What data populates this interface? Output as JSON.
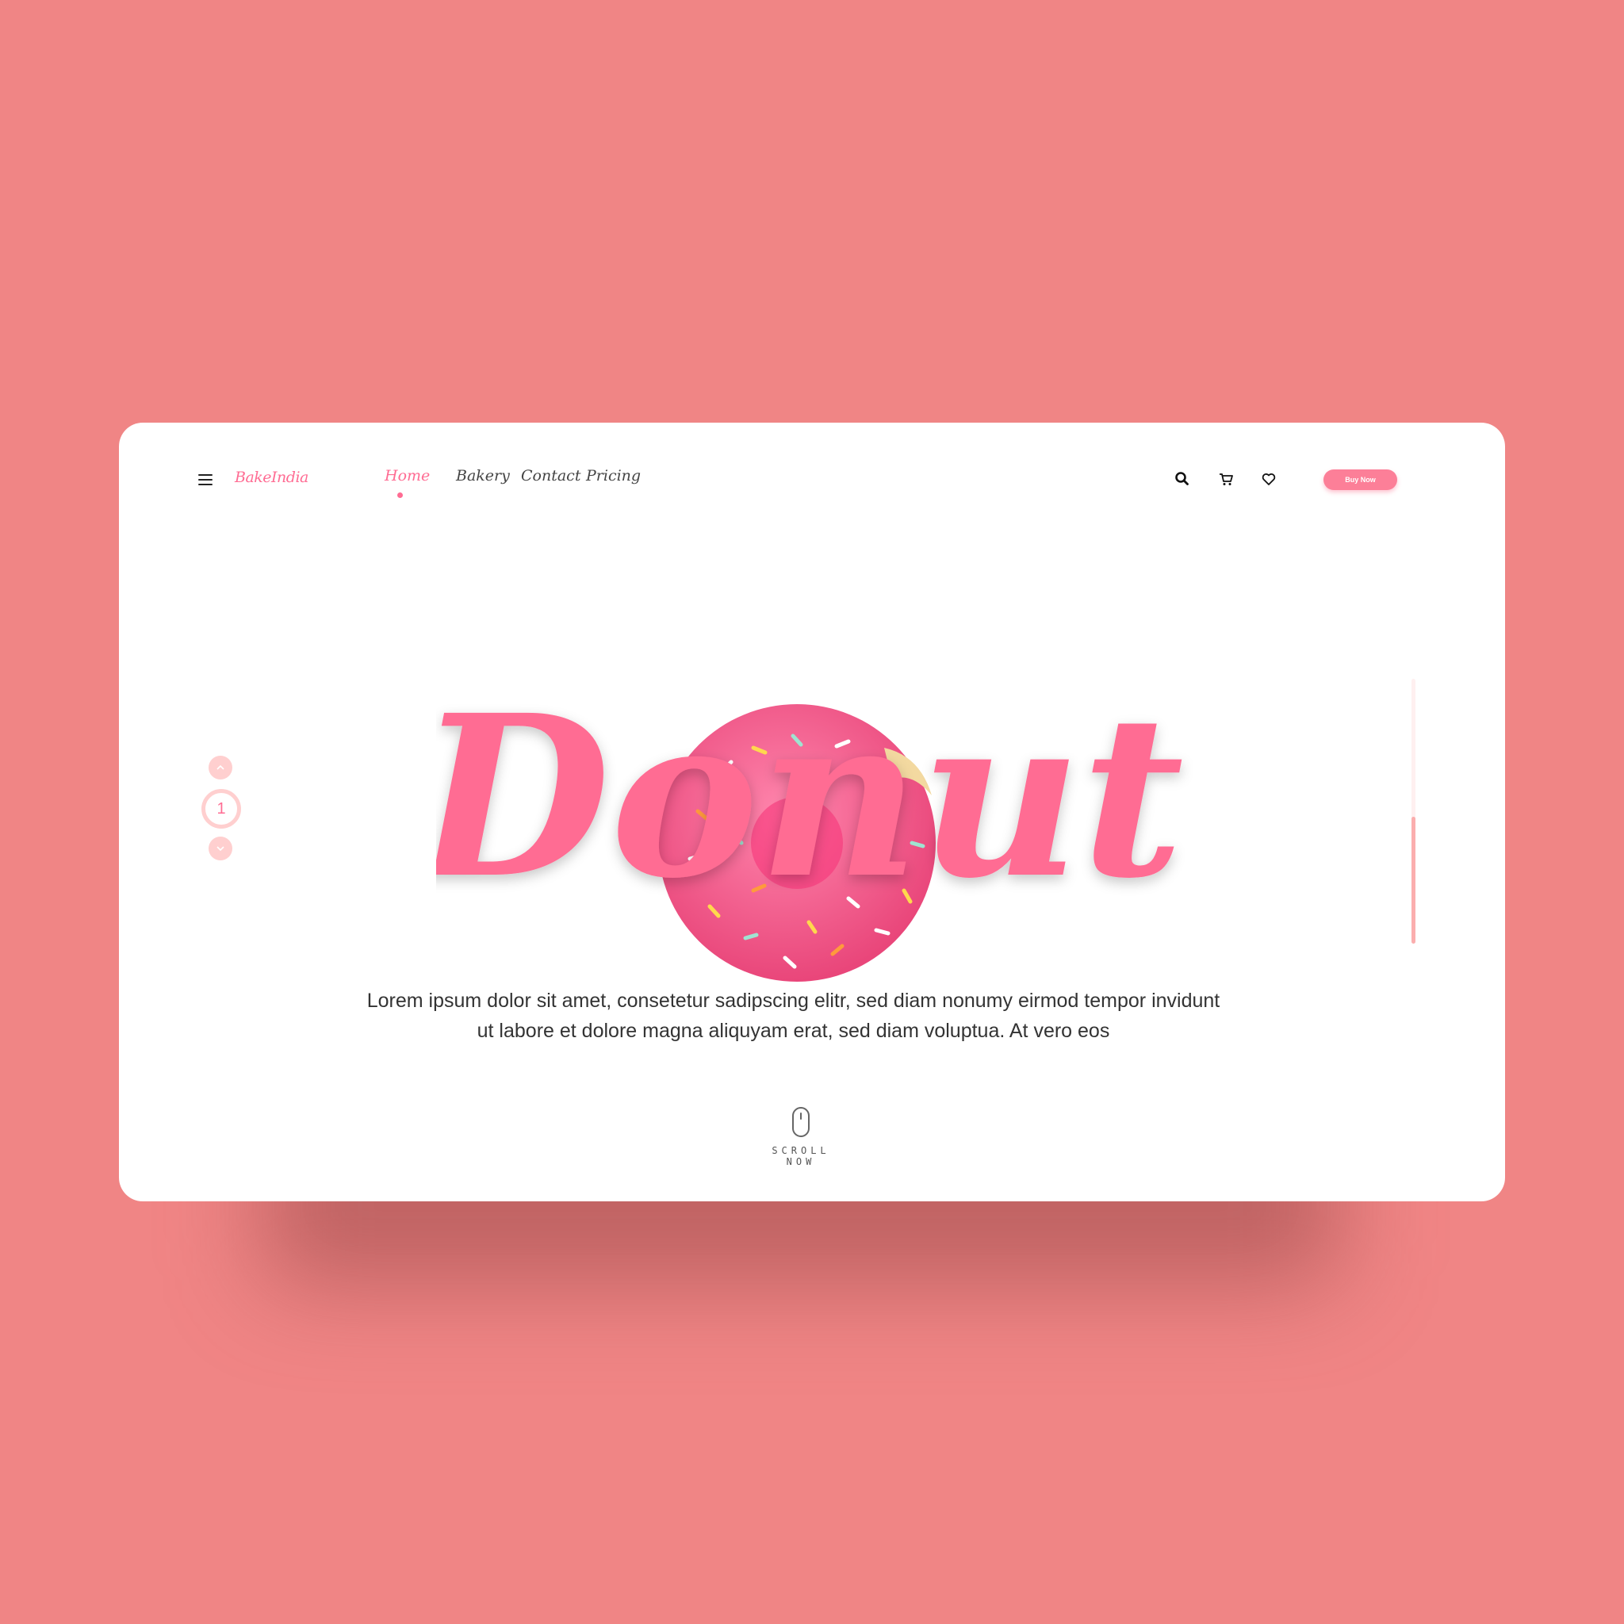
{
  "brand": {
    "logo_text": "BakeIndia",
    "accent_color": "#ff6c93",
    "background_color": "#f08585"
  },
  "nav": {
    "items": [
      {
        "label": "Home",
        "active": true
      },
      {
        "label": "Bakery",
        "active": false
      },
      {
        "label": "Contact",
        "active": false
      },
      {
        "label": "Pricing",
        "active": false
      }
    ]
  },
  "header_icons": [
    "search-icon",
    "cart-icon",
    "heart-icon"
  ],
  "header": {
    "buy_button_label": "Buy Now"
  },
  "hero": {
    "title": "Donut",
    "description": "Lorem ipsum dolor sit amet, consetetur sadipscing elitr, sed diam nonumy eirmod tempor invidunt ut labore et dolore magna aliquyam erat, sed diam voluptua. At vero eos"
  },
  "pager": {
    "current": "1"
  },
  "scroll_hint": {
    "label": "SCROLL NOW"
  },
  "scrollbar": {
    "position_fraction": 0.52,
    "thumb_fraction": 0.48
  }
}
